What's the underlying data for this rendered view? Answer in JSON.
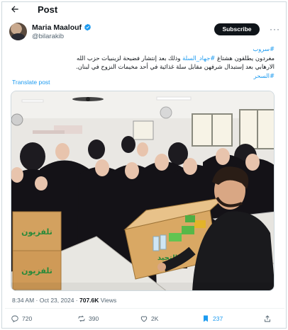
{
  "header": {
    "title": "Post"
  },
  "author": {
    "name": "Maria Maalouf",
    "handle": "@bilarakib",
    "subscribe_label": "Subscribe",
    "more_label": "···"
  },
  "post": {
    "line1_tag": "#سروب",
    "line2_pre": "مغردون يطلقون هشتاغ",
    "line2_tag": "#جهاد_السلة",
    "line2_post": "وذلك بعد إنتشار فضيحة لزينبيات حزب الله",
    "line3": "الارهابي بعد إستبدال شرفهن مقابل سلة غذائية في أحد مخيمات النزوح في لبنان.",
    "line4_tag": "#السحر",
    "translate_label": "Translate post"
  },
  "photo": {
    "box_text_1": "تلفزيون",
    "box_text_2": "التحيد"
  },
  "meta": {
    "time": "8:34 AM",
    "date": "Oct 23, 2024",
    "views_count": "707.6K",
    "views_label": "Views"
  },
  "actions": {
    "replies": "720",
    "reposts": "390",
    "likes": "2K",
    "bookmarks": "237"
  },
  "colors": {
    "accent": "#1d9bf0",
    "text": "#0f1419",
    "muted": "#536471"
  }
}
